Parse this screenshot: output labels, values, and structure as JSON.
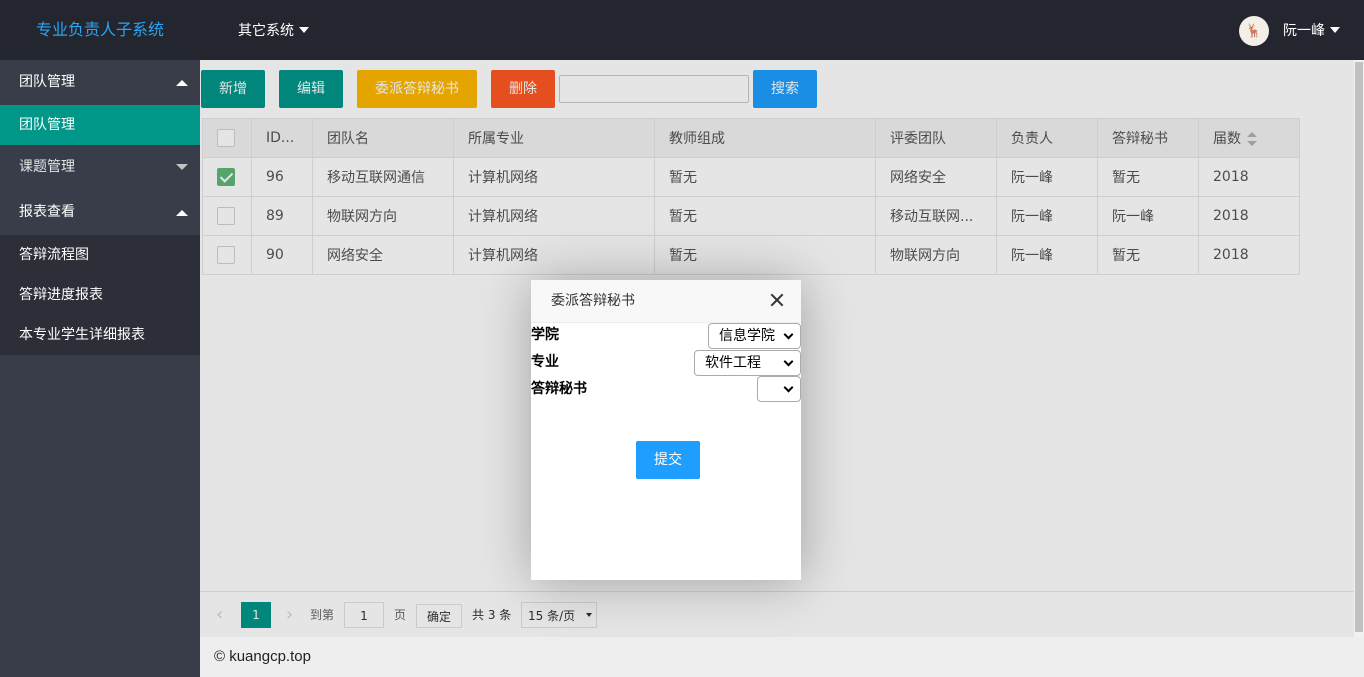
{
  "header": {
    "logo": "专业负责人子系统",
    "nav_other": "其它系统",
    "username": "阮一峰",
    "avatar_glyph": "🦌"
  },
  "sidebar": {
    "groups": [
      {
        "label": "团队管理",
        "expanded": true,
        "items": [
          {
            "label": "团队管理",
            "active": true
          }
        ]
      },
      {
        "label": "课题管理",
        "expanded": false,
        "items": []
      },
      {
        "label": "报表查看",
        "expanded": true,
        "items": [
          {
            "label": "答辩流程图"
          },
          {
            "label": "答辩进度报表"
          },
          {
            "label": "本专业学生详细报表"
          }
        ]
      }
    ]
  },
  "toolbar": {
    "add": "新增",
    "edit": "编辑",
    "assign_secretary": "委派答辩秘书",
    "delete": "删除",
    "search_value": "",
    "search": "搜索",
    "colors": {
      "add": "#009688",
      "edit": "#009688",
      "assign": "#ffb800",
      "delete": "#ff5722",
      "search": "#1e9fff"
    }
  },
  "table": {
    "headers": [
      "ID...",
      "团队名",
      "所属专业",
      "教师组成",
      "评委团队",
      "负责人",
      "答辩秘书",
      "届数"
    ],
    "rows": [
      {
        "checked": true,
        "cells": [
          "96",
          "移动互联网通信",
          "计算机网络",
          "暂无",
          "网络安全",
          "阮一峰",
          "暂无",
          "2018"
        ]
      },
      {
        "checked": false,
        "cells": [
          "89",
          "物联网方向",
          "计算机网络",
          "暂无",
          "移动互联网...",
          "阮一峰",
          "阮一峰",
          "2018"
        ]
      },
      {
        "checked": false,
        "cells": [
          "90",
          "网络安全",
          "计算机网络",
          "暂无",
          "物联网方向",
          "阮一峰",
          "暂无",
          "2018"
        ]
      }
    ]
  },
  "pager": {
    "prev": "‹",
    "current_page": "1",
    "next": "›",
    "goto_label": "到第",
    "goto_value": "1",
    "page_unit": "页",
    "confirm": "确定",
    "total": "共 3 条",
    "page_size": "15 条/页"
  },
  "dialog": {
    "title": "委派答辩秘书",
    "college_label": "学院",
    "college_value": "信息学院",
    "major_label": "专业",
    "major_value": "软件工程",
    "secretary_label": "答辩秘书",
    "secretary_value": "",
    "submit": "提交"
  },
  "footer": {
    "text": "© kuangcp.top"
  }
}
